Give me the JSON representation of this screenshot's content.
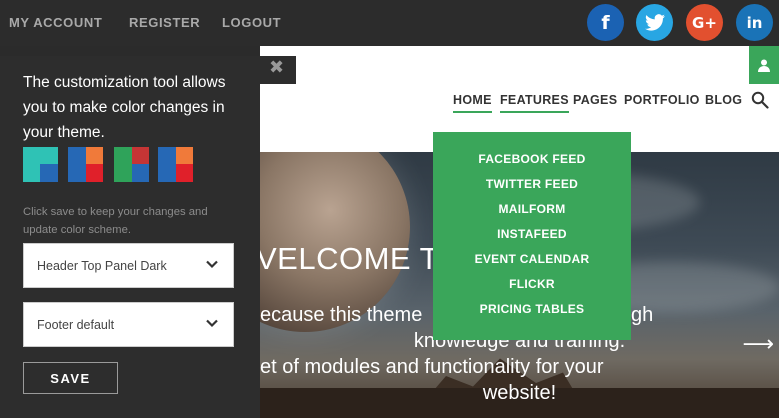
{
  "topbar": {
    "links": [
      "MY ACCOUNT",
      "REGISTER",
      "LOGOUT"
    ],
    "social": [
      {
        "name": "facebook",
        "glyph": "f",
        "color": "#1b62b3"
      },
      {
        "name": "twitter",
        "glyph": "",
        "color": "#28a6e3"
      },
      {
        "name": "google-plus",
        "glyph": "G+",
        "color": "#e2502f"
      },
      {
        "name": "linkedin",
        "glyph": "in",
        "color": "#1a73b7"
      }
    ]
  },
  "nav": {
    "items": [
      "HOME",
      "FEATURES",
      "PAGES",
      "PORTFOLIO",
      "BLOG"
    ],
    "active": [
      "HOME",
      "FEATURES"
    ],
    "accent": "#3aa65a"
  },
  "features_menu": {
    "items": [
      "FACEBOOK FEED",
      "TWITTER FEED",
      "MAILFORM",
      "INSTAFEED",
      "EVENT CALENDAR",
      "FLICKR",
      "PRICING TABLES"
    ]
  },
  "hero": {
    "title": "VELCOME TO",
    "lines": [
      "ecause this theme",
      "knowledge and training.",
      "et of modules and functionality for your",
      "website!"
    ],
    "tail": "gh"
  },
  "panel": {
    "intro": "The customization tool allows you to make color changes in your theme.",
    "hint": "Click save to keep your changes and update color scheme.",
    "header_select": "Header Top Panel Dark",
    "footer_select": "Footer default",
    "save_label": "SAVE",
    "swatches": [
      [
        "#2fc2b5",
        "#3b8fd0",
        "#2fc2b5",
        "#2668b5"
      ],
      [
        "#2668b5",
        "#f07a3a",
        "#2668b5",
        "#e0202a"
      ],
      [
        "#2fa35a",
        "#c53535",
        "#2fa35a",
        "#2668b5"
      ],
      [
        "#2668b5",
        "#f07a3a",
        "#2668b5",
        "#e0202a"
      ]
    ]
  }
}
